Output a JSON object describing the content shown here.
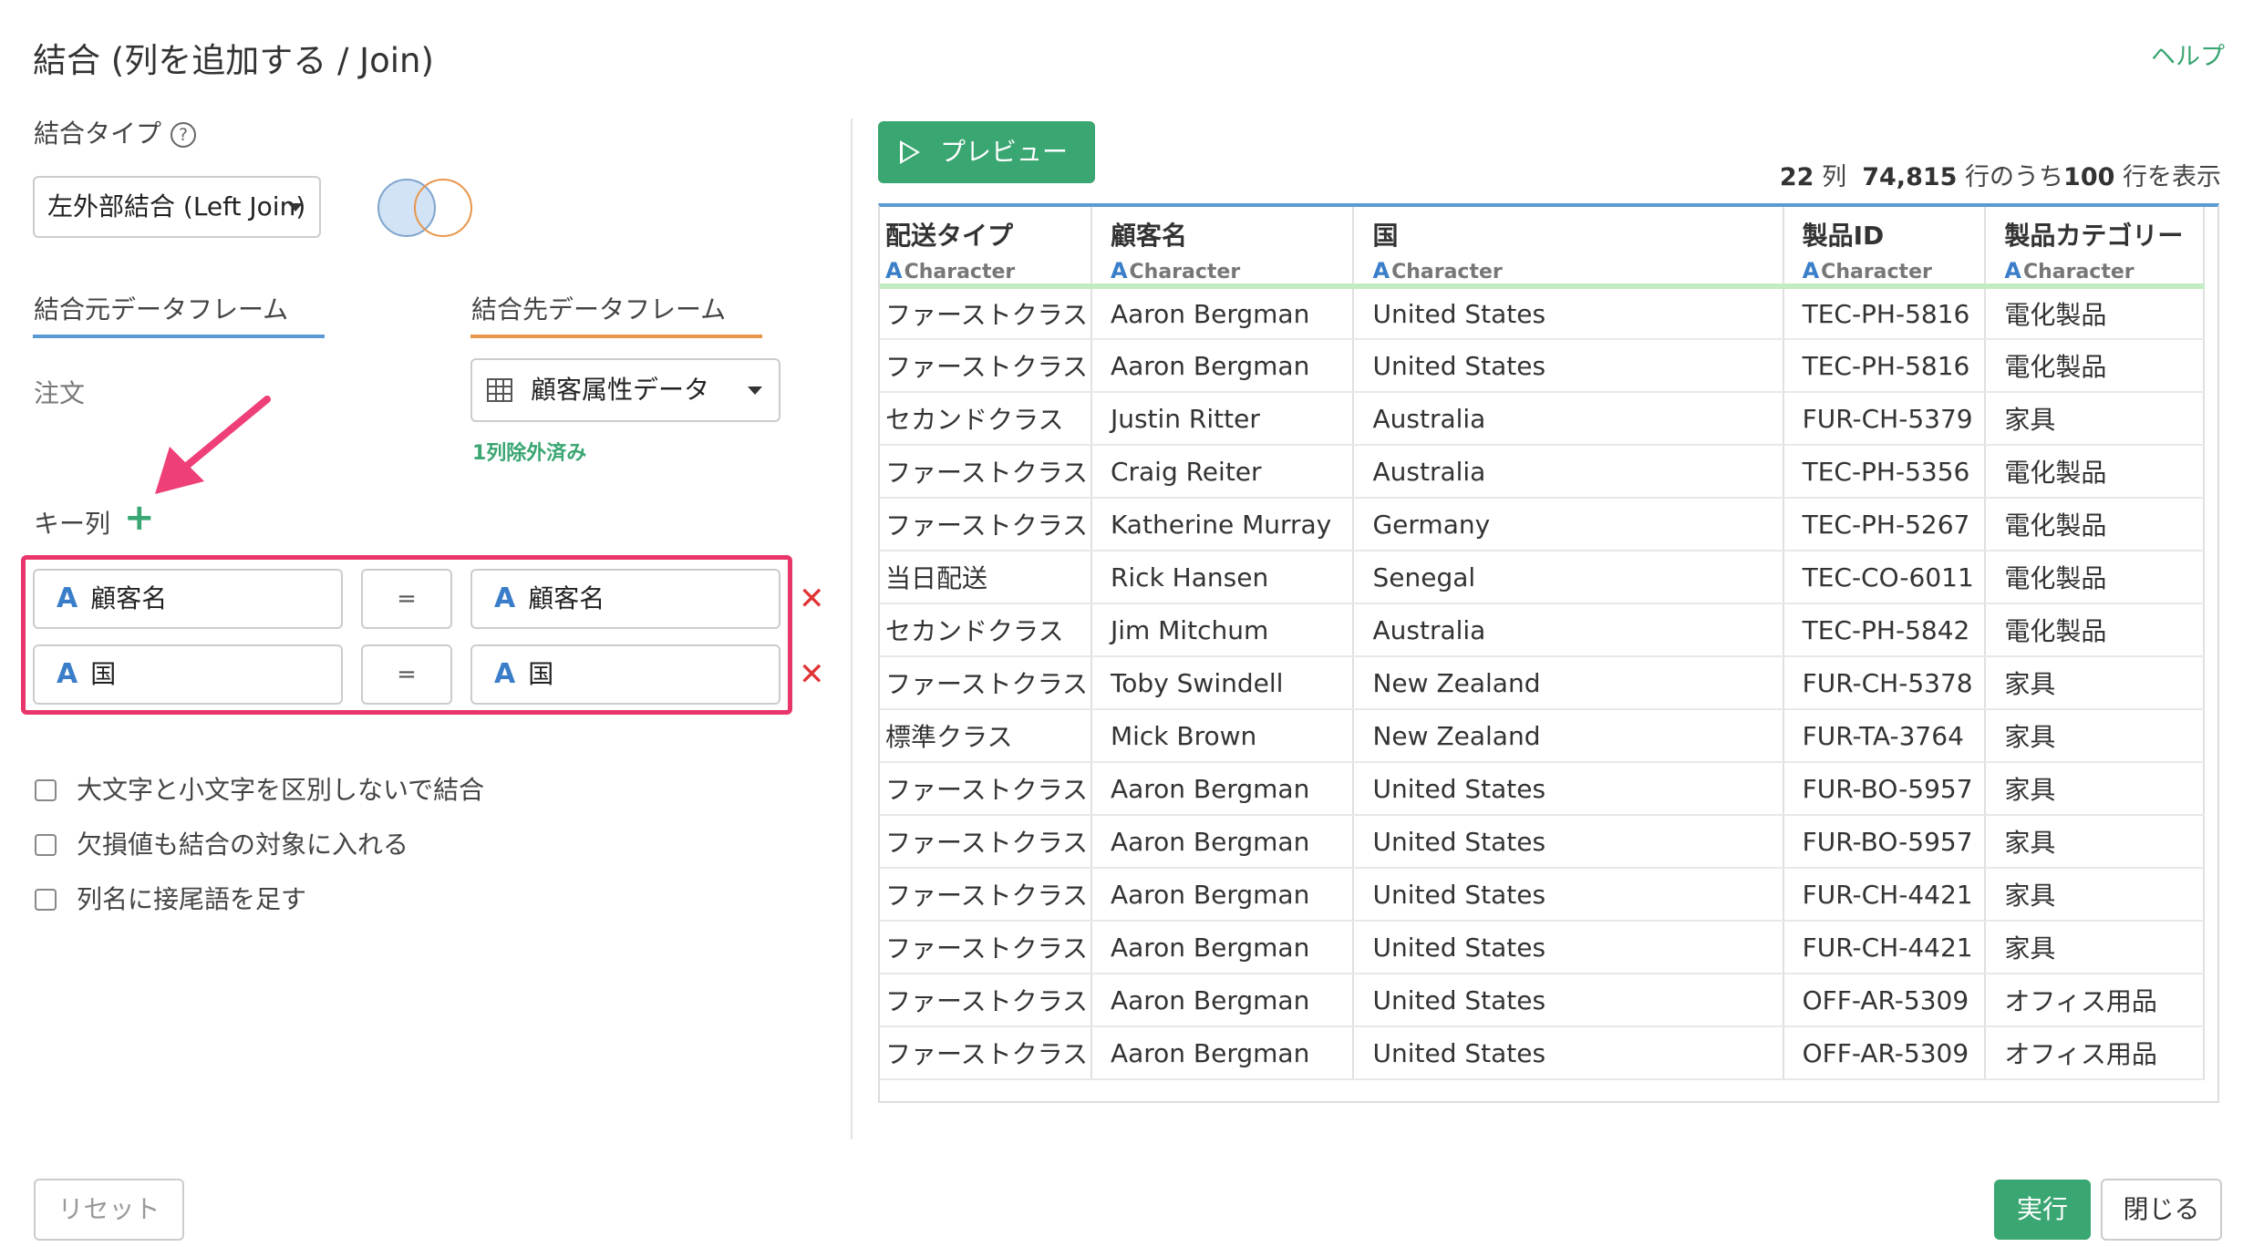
{
  "dialog": {
    "title": "結合 (列を追加する / Join)",
    "help_label": "ヘルプ"
  },
  "join_type": {
    "label": "結合タイプ",
    "help_icon": "question-circle-icon",
    "selected": "左外部結合 (Left Join)"
  },
  "source_tab": {
    "label": "結合元データフレーム",
    "value": "注文",
    "accent": "#5b9bd5"
  },
  "target_tab": {
    "label": "結合先データフレーム",
    "selected": "顧客属性データ",
    "note": "1列除外済み",
    "accent": "#e8964b"
  },
  "key_columns": {
    "label": "キー列",
    "add_icon": "plus",
    "rows": [
      {
        "left_type": "A",
        "left": "顧客名",
        "op": "=",
        "right_type": "A",
        "right": "顧客名"
      },
      {
        "left_type": "A",
        "left": "国",
        "op": "=",
        "right_type": "A",
        "right": "国"
      }
    ]
  },
  "options": [
    {
      "label": "大文字と小文字を区別しないで結合",
      "checked": false
    },
    {
      "label": "欠損値も結合の対象に入れる",
      "checked": false
    },
    {
      "label": "列名に接尾語を足す",
      "checked": false
    }
  ],
  "preview": {
    "button_label": "プレビュー",
    "cols_count": "22",
    "cols_unit": "列",
    "total_rows": "74,815",
    "rows_mid": "行のうち",
    "shown_rows": "100",
    "rows_tail": "行を表示",
    "columns": [
      {
        "name": "配送タイプ",
        "type": "Character"
      },
      {
        "name": "顧客名",
        "type": "Character"
      },
      {
        "name": "国",
        "type": "Character"
      },
      {
        "name": "製品ID",
        "type": "Character"
      },
      {
        "name": "製品カテゴリー",
        "type": "Character"
      }
    ],
    "rows": [
      [
        "ファーストクラス",
        "Aaron Bergman",
        "United States",
        "TEC-PH-5816",
        "電化製品"
      ],
      [
        "ファーストクラス",
        "Aaron Bergman",
        "United States",
        "TEC-PH-5816",
        "電化製品"
      ],
      [
        "セカンドクラス",
        "Justin Ritter",
        "Australia",
        "FUR-CH-5379",
        "家具"
      ],
      [
        "ファーストクラス",
        "Craig Reiter",
        "Australia",
        "TEC-PH-5356",
        "電化製品"
      ],
      [
        "ファーストクラス",
        "Katherine Murray",
        "Germany",
        "TEC-PH-5267",
        "電化製品"
      ],
      [
        "当日配送",
        "Rick Hansen",
        "Senegal",
        "TEC-CO-6011",
        "電化製品"
      ],
      [
        "セカンドクラス",
        "Jim Mitchum",
        "Australia",
        "TEC-PH-5842",
        "電化製品"
      ],
      [
        "ファーストクラス",
        "Toby Swindell",
        "New Zealand",
        "FUR-CH-5378",
        "家具"
      ],
      [
        "標準クラス",
        "Mick Brown",
        "New Zealand",
        "FUR-TA-3764",
        "家具"
      ],
      [
        "ファーストクラス",
        "Aaron Bergman",
        "United States",
        "FUR-BO-5957",
        "家具"
      ],
      [
        "ファーストクラス",
        "Aaron Bergman",
        "United States",
        "FUR-BO-5957",
        "家具"
      ],
      [
        "ファーストクラス",
        "Aaron Bergman",
        "United States",
        "FUR-CH-4421",
        "家具"
      ],
      [
        "ファーストクラス",
        "Aaron Bergman",
        "United States",
        "FUR-CH-4421",
        "家具"
      ],
      [
        "ファーストクラス",
        "Aaron Bergman",
        "United States",
        "OFF-AR-5309",
        "オフィス用品"
      ],
      [
        "ファーストクラス",
        "Aaron Bergman",
        "United States",
        "OFF-AR-5309",
        "オフィス用品"
      ]
    ]
  },
  "footer": {
    "reset_label": "リセット",
    "run_label": "実行",
    "close_label": "閉じる"
  },
  "colors": {
    "primary_green": "#3aa672",
    "highlight_pink": "#e8366a",
    "delete_red": "#e03434"
  }
}
